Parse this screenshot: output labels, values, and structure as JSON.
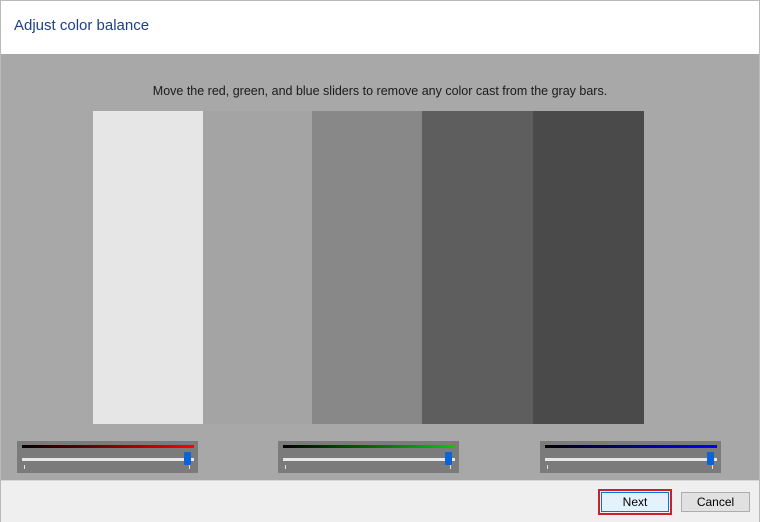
{
  "window": {
    "title": "Adjust color balance"
  },
  "main": {
    "instruction": "Move the red, green, and blue sliders to remove any color cast from the gray bars.",
    "gray_bars": [
      "#e6e6e6",
      "#a4a4a4",
      "#888888",
      "#5e5e5e",
      "#4a4a4a"
    ]
  },
  "sliders": [
    {
      "channel": "red",
      "color": "#ff0000",
      "value": 1.0
    },
    {
      "channel": "green",
      "color": "#00cc00",
      "value": 1.0
    },
    {
      "channel": "blue",
      "color": "#0000ff",
      "value": 1.0
    }
  ],
  "footer": {
    "next_label": "Next",
    "cancel_label": "Cancel"
  }
}
